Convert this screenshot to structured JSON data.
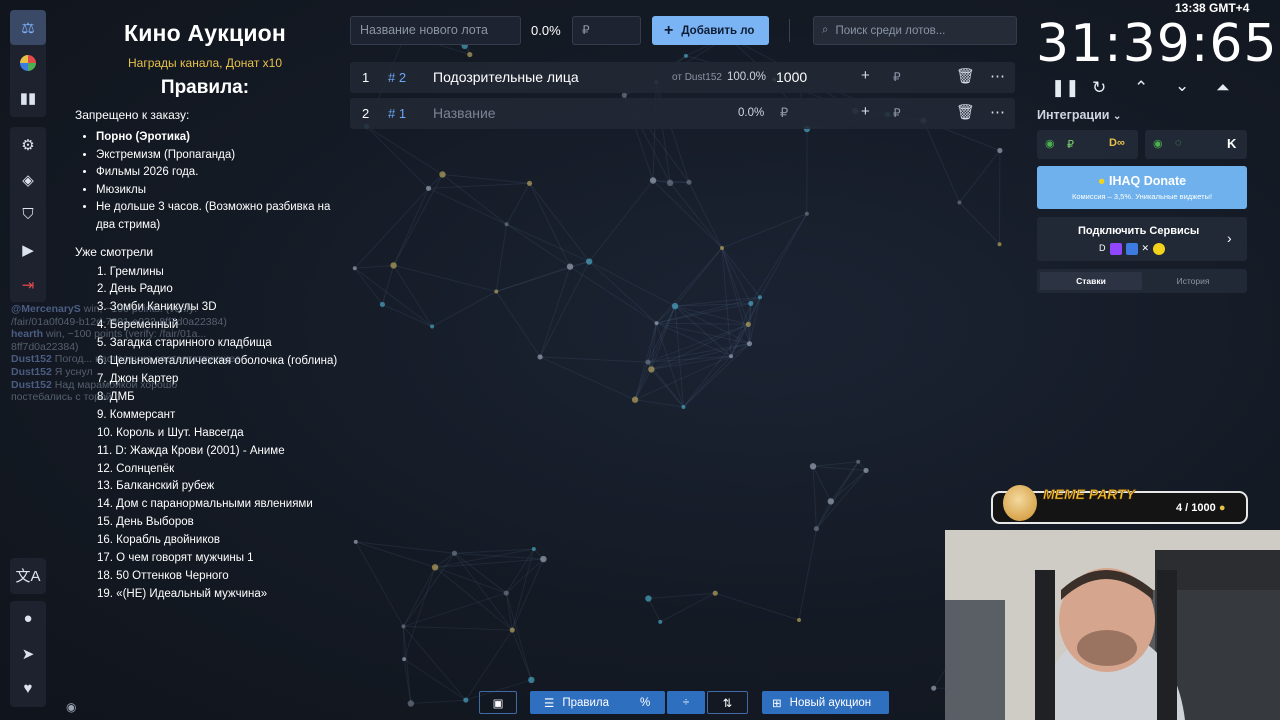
{
  "app": {
    "title": "Кино Аукцион",
    "subtitle": "Награды канала, Донат x10",
    "rules_heading": "Правила:"
  },
  "rules": {
    "forbidden_label": "Запрещено к заказу:",
    "forbidden": [
      "Порно (Эротика)",
      "Экстремизм (Пропаганда)",
      "Фильмы 2026 года.",
      "Мюзиклы",
      "Не дольше 3 часов. (Возможно разбивка на два стрима)"
    ],
    "watched_label": "Уже смотрели",
    "watched": [
      "1. Гремлины",
      "2. День Радио",
      "3. Зомби Каникулы 3D",
      "4. Беременный",
      "5. Загадка старинного кладбища",
      "6. Цельнометаллическая оболочка (гоблина)",
      "7. Джон Картер",
      "8. ДМБ",
      "9. Коммерсант",
      "10. Король и Шут. Навсегда",
      "11. D: Жажда Крови (2001) - Аниме",
      "12. Солнцепёк",
      "13. Балканский рубеж",
      "14. Дом с паранормальными явлениями",
      "15. День Выборов",
      "16. Корабль двойников",
      "17. О чем говорят мужчины 1",
      "18. 50 Оттенков Черного",
      "19. «(НЕ) Идеальный мужчина»"
    ]
  },
  "chat": [
    {
      "user": "@MercenaryS",
      "text": "win, −100 points. (verify: /fair/01a0f049-b12d-7801-a032-8ff7d0a22384)"
    },
    {
      "user": "hearth",
      "text": "win, −100 points (verify: /fair/01a... 8ff7d0a22384)"
    },
    {
      "user": "Dust152",
      "text": "Погод... настроение соответствующее"
    },
    {
      "user": "Dust152",
      "text": "Я уснул"
    },
    {
      "user": "Dust152",
      "text": "Над марамойкой хорошо постебались с торой"
    }
  ],
  "toolbar": {
    "lot_placeholder": "Название нового лота",
    "percent": "0.0%",
    "amount_placeholder": "₽",
    "add_label": "Добавить ло",
    "search_placeholder": "Поиск среди лотов..."
  },
  "lots": [
    {
      "num": "1",
      "id": "# 2",
      "name": "Подозрительные лица",
      "from": "от Dust152",
      "percent": "100.0%",
      "amount": "1000",
      "currency": "₽"
    },
    {
      "num": "2",
      "id": "# 1",
      "name": "Название",
      "from": "",
      "percent": "0.0%",
      "amount": "",
      "currency": "₽"
    }
  ],
  "timer": {
    "value": "31:39:65",
    "clock": "13:38  GMT+4"
  },
  "right": {
    "integrations_label": "Интеграции",
    "donate_title": "IHAQ Donate",
    "donate_sub": "Комиссия – 3,5%. Уникальные виджеты!",
    "connect_label": "Подключить Сервисы",
    "tab_bets": "Ставки",
    "tab_history": "История"
  },
  "meme": {
    "title": "MEME PARTY",
    "count": "4 / 1000"
  },
  "bottom": {
    "rules_label": "Правила",
    "new_auction_label": "Новый аукцион"
  },
  "colors": {
    "accent": "#7ab4f5",
    "blue_button": "#2f6fbf",
    "gold": "#e6c14a",
    "danger": "#e24a4a"
  }
}
